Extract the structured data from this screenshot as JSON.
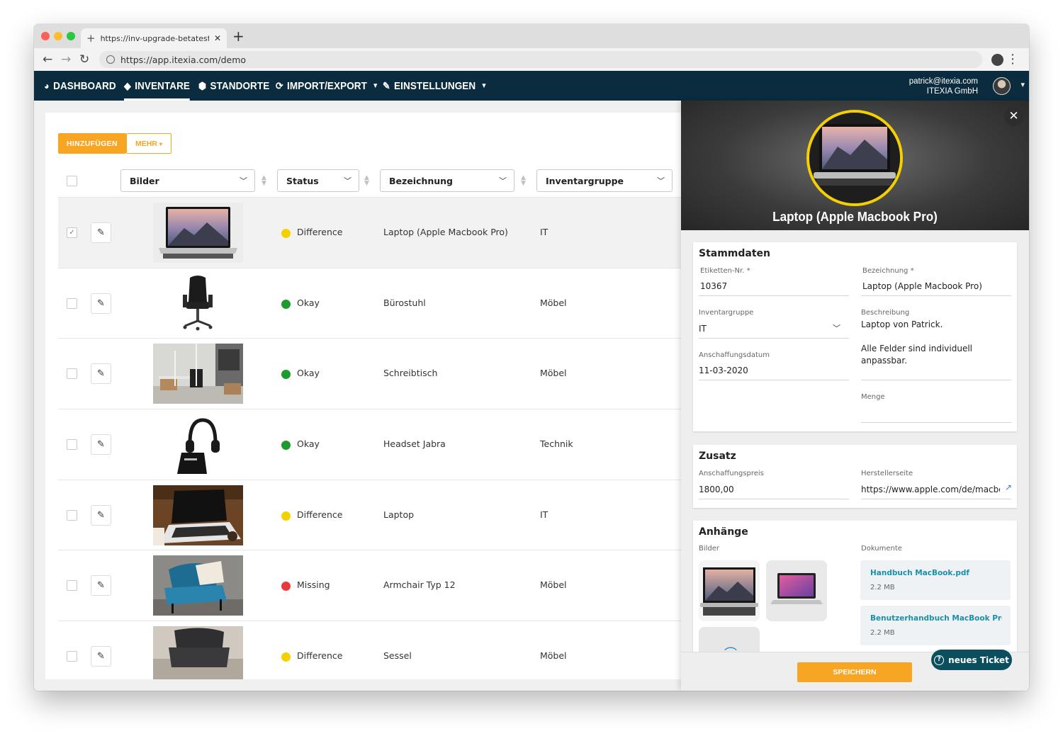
{
  "browser": {
    "tab_title": "https://inv-upgrade-betatest.it",
    "url": "https://app.itexia.com/demo"
  },
  "nav": {
    "items": [
      {
        "label": "DASHBOARD",
        "icon": "pie-chart-icon"
      },
      {
        "label": "INVENTARE",
        "icon": "tag-icon"
      },
      {
        "label": "STANDORTE",
        "icon": "cube-icon"
      },
      {
        "label": "IMPORT/EXPORT",
        "icon": "sync-icon"
      },
      {
        "label": "EINSTELLUNGEN",
        "icon": "wrench-icon"
      }
    ],
    "user_email": "patrick@itexia.com",
    "user_company": "ITEXIA GmbH"
  },
  "toolbar": {
    "add_label": "HINZUFÜGEN",
    "more_label": "MEHR"
  },
  "table": {
    "columns": [
      "Bilder",
      "Status",
      "Bezeichnung",
      "Inventargruppe"
    ],
    "rows": [
      {
        "status": "Difference",
        "status_color": "#f5d000",
        "name": "Laptop (Apple Macbook Pro)",
        "group": "IT",
        "image": "macbook",
        "selected": true
      },
      {
        "status": "Okay",
        "status_color": "#1e9a2f",
        "name": "Bürostuhl",
        "group": "Möbel",
        "image": "chair",
        "selected": false
      },
      {
        "status": "Okay",
        "status_color": "#1e9a2f",
        "name": "Schreibtisch",
        "group": "Möbel",
        "image": "office",
        "selected": false
      },
      {
        "status": "Okay",
        "status_color": "#1e9a2f",
        "name": "Headset Jabra",
        "group": "Technik",
        "image": "headset",
        "selected": false
      },
      {
        "status": "Difference",
        "status_color": "#f5d000",
        "name": "Laptop",
        "group": "IT",
        "image": "laptop-desk",
        "selected": false
      },
      {
        "status": "Missing",
        "status_color": "#e83a3a",
        "name": "Armchair Typ 12",
        "group": "Möbel",
        "image": "armchair",
        "selected": false
      },
      {
        "status": "Difference",
        "status_color": "#f5d000",
        "name": "Sessel",
        "group": "Möbel",
        "image": "sessel",
        "selected": false
      }
    ]
  },
  "detail": {
    "title": "Laptop (Apple Macbook Pro)",
    "stammdaten": {
      "heading": "Stammdaten",
      "etikett_label": "Etiketten-Nr. *",
      "etikett_value": "10367",
      "bezeichnung_label": "Bezeichnung *",
      "bezeichnung_value": "Laptop (Apple Macbook Pro)",
      "gruppe_label": "Inventargruppe",
      "gruppe_value": "IT",
      "beschreibung_label": "Beschreibung",
      "beschreibung_line1": "Laptop von Patrick.",
      "beschreibung_line2": "Alle Felder sind individuell",
      "beschreibung_line3": "anpassbar.",
      "datum_label": "Anschaffungsdatum",
      "datum_value": "11-03-2020",
      "menge_label": "Menge"
    },
    "zusatz": {
      "heading": "Zusatz",
      "preis_label": "Anschaffungspreis",
      "preis_value": "1800,00",
      "hersteller_label": "Herstellerseite",
      "hersteller_value": "https://www.apple.com/de/macbook"
    },
    "anhaenge": {
      "heading": "Anhänge",
      "bilder_label": "Bilder",
      "dokumente_label": "Dokumente",
      "documents": [
        {
          "name": "Handbuch MacBook.pdf",
          "size": "2.2 MB"
        },
        {
          "name": "Benutzerhandbuch MacBook Pro....",
          "size": "2.2 MB"
        }
      ]
    },
    "save_label": "SPEICHERN",
    "ticket_label": "neues Ticket"
  }
}
